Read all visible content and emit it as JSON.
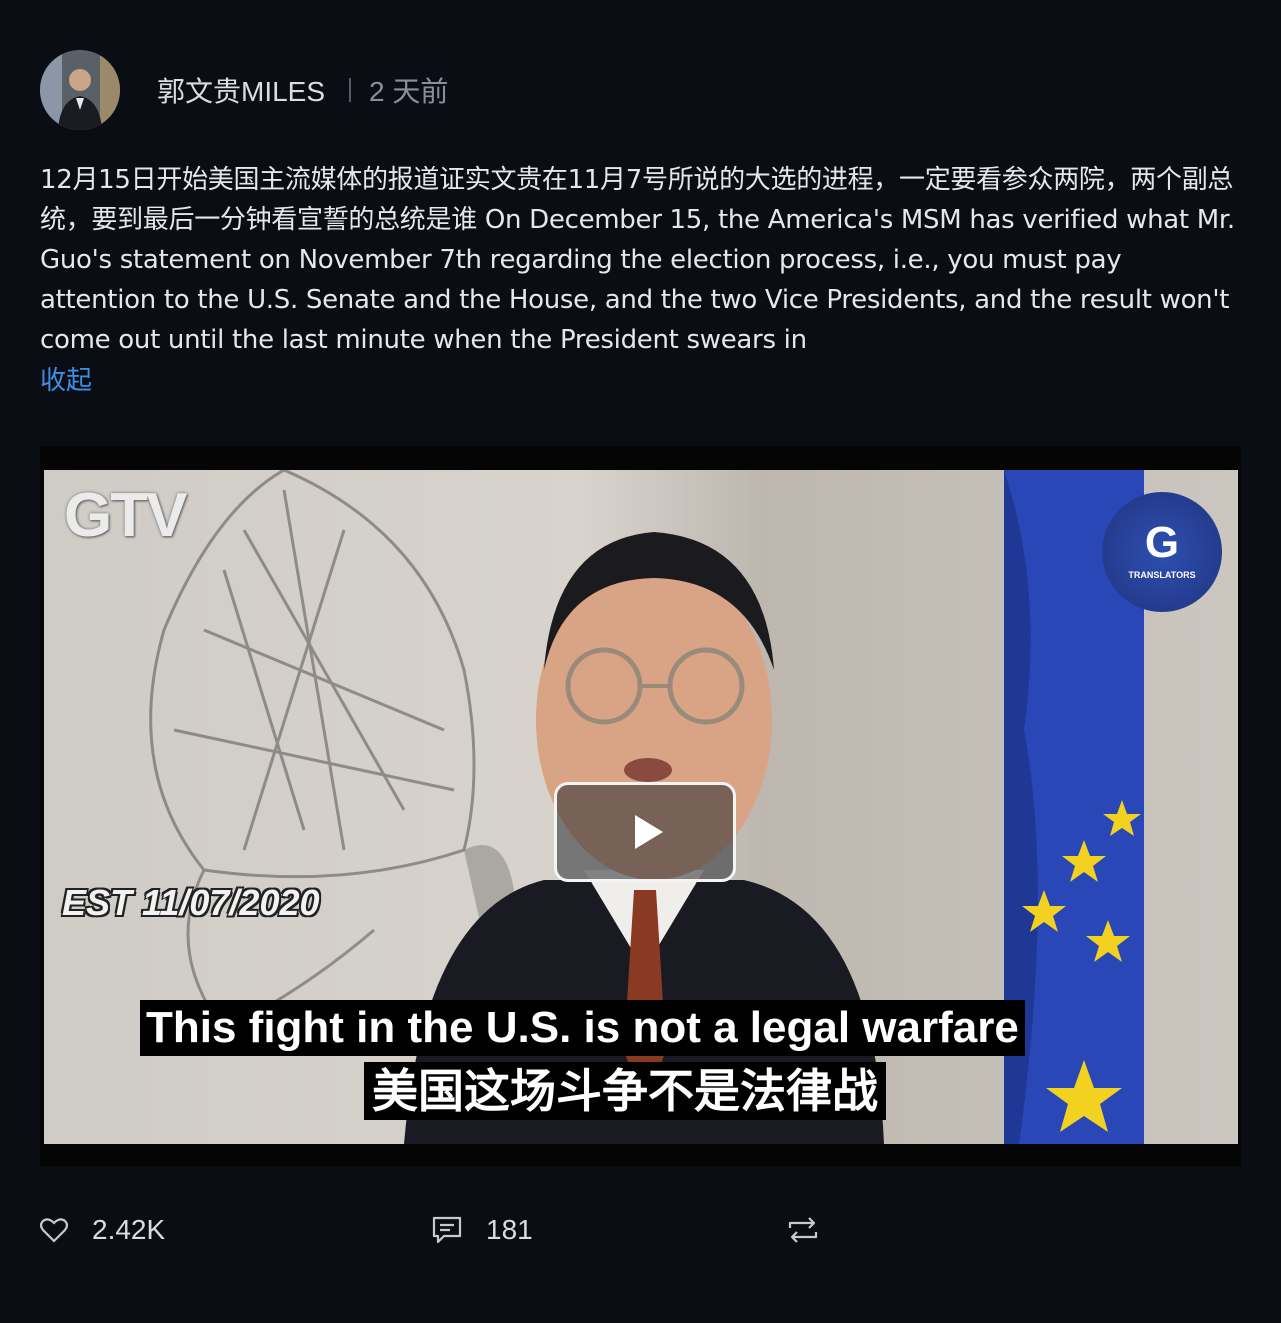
{
  "post": {
    "author": "郭文贵MILES",
    "time": "2 天前",
    "text": "12月15日开始美国主流媒体的报道证实文贵在11月7号所说的大选的进程，一定要看参众两院，两个副总统，要到最后一分钟看宣誓的总统是谁 On December 15, the America's MSM has verified what Mr. Guo's statement on November 7th regarding the election process, i.e., you must pay attention to the U.S. Senate and the House, and the two Vice Presidents, and the result won't come out until the last minute when the President swears in",
    "collapse_label": "收起"
  },
  "video": {
    "logo_text": "GTV",
    "date_overlay": "EST 11/07/2020",
    "subtitle_en": "This fight in the U.S. is not a legal warfare",
    "subtitle_zh": "美国这场斗争不是法律战",
    "badge_letter": "G",
    "badge_text": "TRANSLATORS",
    "play_icon": "play-icon"
  },
  "actions": {
    "likes": "2.42K",
    "comments": "181",
    "like_icon": "heart-icon",
    "comment_icon": "comment-icon",
    "repost_icon": "repost-icon"
  }
}
